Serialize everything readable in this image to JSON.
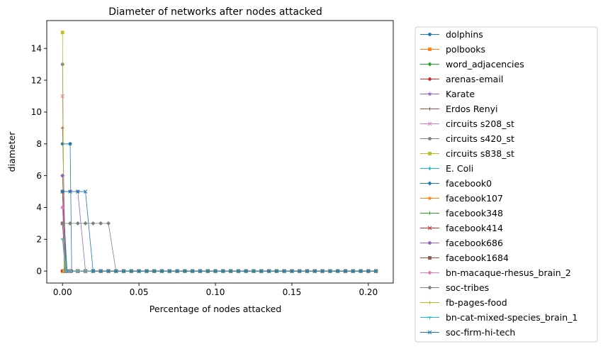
{
  "chart_data": {
    "type": "line",
    "title": "Diameter of networks after nodes attacked",
    "xlabel": "Percentage of nodes attacked",
    "ylabel": "diameter",
    "xlim": [
      -0.0103,
      0.2163
    ],
    "ylim": [
      -0.75,
      15.75
    ],
    "xticks": [
      0.0,
      0.05,
      0.1,
      0.15,
      0.2
    ],
    "xtick_labels": [
      "0.00",
      "0.05",
      "0.10",
      "0.15",
      "0.20"
    ],
    "yticks": [
      0,
      2,
      4,
      6,
      8,
      10,
      12,
      14
    ],
    "ytick_labels": [
      "0",
      "2",
      "4",
      "6",
      "8",
      "10",
      "12",
      "14"
    ],
    "grid": false,
    "legend_position": "outside-right",
    "x": [
      0,
      0.005,
      0.01,
      0.015,
      0.02,
      0.025,
      0.03,
      0.035,
      0.04,
      0.045,
      0.05,
      0.055,
      0.06,
      0.065,
      0.07,
      0.075,
      0.08,
      0.085,
      0.09,
      0.095,
      0.1,
      0.105,
      0.11,
      0.115,
      0.12,
      0.125,
      0.13,
      0.135,
      0.14,
      0.145,
      0.15,
      0.155,
      0.16,
      0.165,
      0.17,
      0.175,
      0.18,
      0.185,
      0.19,
      0.195,
      0.2,
      0.205
    ],
    "series": [
      {
        "name": "dolphins",
        "color": "#1f77b4",
        "marker": "circle",
        "x": [
          0,
          0.005,
          0.006,
          0.205
        ],
        "values": [
          8,
          8,
          0,
          0
        ]
      },
      {
        "name": "polbooks",
        "color": "#ff7f0e",
        "marker": "square",
        "x": [
          0,
          0.001,
          0.205
        ],
        "values": [
          0,
          0,
          0
        ]
      },
      {
        "name": "word_adjacencies",
        "color": "#2ca02c",
        "marker": "diamond",
        "x": [
          0,
          0.0025,
          0.205
        ],
        "values": [
          6,
          0,
          0
        ]
      },
      {
        "name": "arenas-email",
        "color": "#d62728",
        "marker": "diamond",
        "x": [
          0,
          0.001,
          0.205
        ],
        "values": [
          0,
          0,
          0
        ]
      },
      {
        "name": "Karate",
        "color": "#9467bd",
        "marker": "star",
        "x": [
          0,
          0.005,
          0.01,
          0.015,
          0.205
        ],
        "values": [
          5,
          5,
          5,
          0,
          0
        ]
      },
      {
        "name": "Erdos Renyi",
        "color": "#8c564b",
        "marker": "plus",
        "x": [
          0,
          0.002,
          0.205
        ],
        "values": [
          9,
          0,
          0
        ]
      },
      {
        "name": "circuits s208_st",
        "color": "#e377c2",
        "marker": "x",
        "x": [
          0,
          0.0015,
          0.205
        ],
        "values": [
          11,
          0,
          0
        ]
      },
      {
        "name": "circuits s420_st",
        "color": "#7f7f7f",
        "marker": "circle",
        "x": [
          0,
          0.0012,
          0.205
        ],
        "values": [
          13,
          0,
          0
        ]
      },
      {
        "name": "circuits s838_st",
        "color": "#bcbd22",
        "marker": "square",
        "x": [
          0,
          0.001,
          0.205
        ],
        "values": [
          15,
          0,
          0
        ]
      },
      {
        "name": "E. Coli",
        "color": "#17becf",
        "marker": "thin_diamond",
        "x": [
          0,
          0.002,
          0.205
        ],
        "values": [
          4,
          0,
          0
        ]
      },
      {
        "name": "facebook0",
        "color": "#1f77b4",
        "marker": "diamond",
        "x": [
          0,
          0.003,
          0.205
        ],
        "values": [
          5,
          0,
          0
        ]
      },
      {
        "name": "facebook107",
        "color": "#ff7f0e",
        "marker": "star",
        "x": [
          0,
          0.002,
          0.205
        ],
        "values": [
          3,
          0,
          0
        ]
      },
      {
        "name": "facebook348",
        "color": "#2ca02c",
        "marker": "plus",
        "x": [
          0,
          0.002,
          0.205
        ],
        "values": [
          5,
          0,
          0
        ]
      },
      {
        "name": "facebook414",
        "color": "#d62728",
        "marker": "x",
        "x": [
          0,
          0.002,
          0.205
        ],
        "values": [
          5,
          0,
          0
        ]
      },
      {
        "name": "facebook686",
        "color": "#9467bd",
        "marker": "circle",
        "x": [
          0,
          0.002,
          0.205
        ],
        "values": [
          6,
          0,
          0
        ]
      },
      {
        "name": "facebook1684",
        "color": "#8c564b",
        "marker": "square",
        "x": [
          0,
          0.002,
          0.205
        ],
        "values": [
          3,
          0,
          0
        ]
      },
      {
        "name": "bn-macaque-rhesus_brain_2",
        "color": "#e377c2",
        "marker": "diamond",
        "x": [
          0,
          0.002,
          0.205
        ],
        "values": [
          4,
          0,
          0
        ]
      },
      {
        "name": "soc-tribes",
        "color": "#7f7f7f",
        "marker": "diamond",
        "x": [
          0,
          0.005,
          0.01,
          0.015,
          0.02,
          0.025,
          0.03,
          0.035,
          0.205
        ],
        "values": [
          3,
          3,
          3,
          3,
          3,
          3,
          3,
          0,
          0
        ]
      },
      {
        "name": "fb-pages-food",
        "color": "#bcbd22",
        "marker": "plus",
        "x": [
          0,
          0.002,
          0.205
        ],
        "values": [
          2,
          0,
          0
        ]
      },
      {
        "name": "bn-cat-mixed-species_brain_1",
        "color": "#17becf",
        "marker": "tri",
        "x": [
          0,
          0.002,
          0.205
        ],
        "values": [
          2,
          0,
          0
        ]
      },
      {
        "name": "soc-firm-hi-tech",
        "color": "#1f77b4",
        "marker": "x",
        "x": [
          0,
          0.005,
          0.01,
          0.015,
          0.02,
          0.205
        ],
        "values": [
          5,
          5,
          5,
          5,
          0,
          0
        ]
      }
    ]
  }
}
